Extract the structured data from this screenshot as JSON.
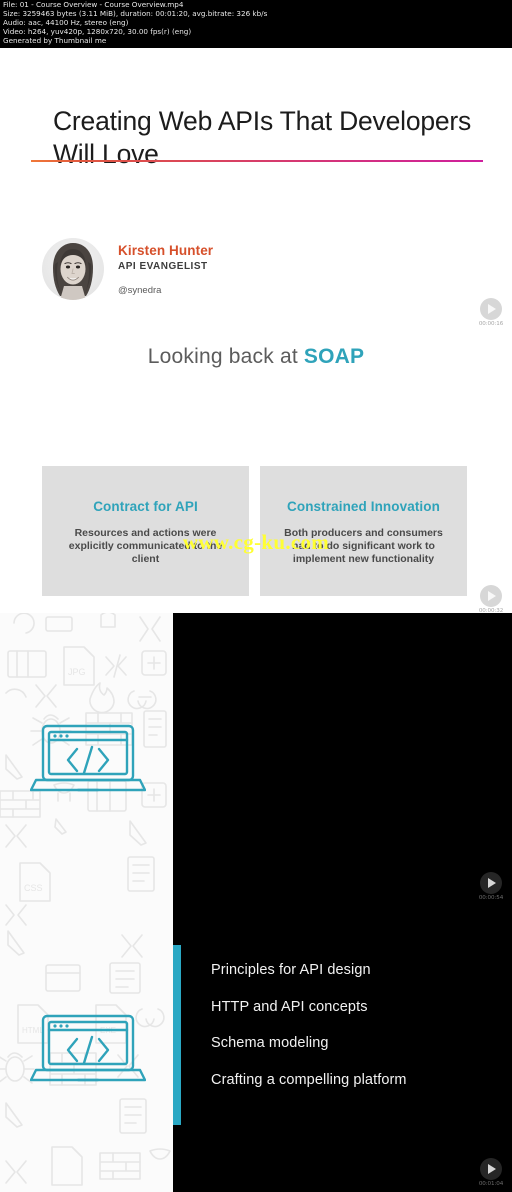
{
  "info_header": {
    "lines": [
      "File: 01 - Course Overview - Course Overview.mp4",
      "Size: 3259463 bytes (3.11 MiB), duration: 00:01:20, avg.bitrate: 326 kb/s",
      "Audio: aac, 44100 Hz, stereo (eng)",
      "Video: h264, yuv420p, 1280x720, 30.00 fps(r) (eng)",
      "Generated by Thumbnail me"
    ]
  },
  "title_slide": {
    "title": "Creating Web APIs That Developers Will Love",
    "author_name": "Kirsten Hunter",
    "author_role": "API EVANGELIST",
    "author_handle": "@synedra",
    "avatar_icon": "person-photo-avatar",
    "rule_gradient_from": "#f07838",
    "rule_gradient_to": "#cf1f9d",
    "author_name_color": "#d6502b"
  },
  "soap_slide": {
    "heading_prefix": "Looking back at ",
    "heading_keyword": "SOAP",
    "keyword_color": "#2fa3ba",
    "cards": [
      {
        "head": "Contract for API",
        "body": "Resources and actions were explicitly communicated to the client"
      },
      {
        "head": "Constrained Innovation",
        "body": "Both producers and consumers had to do significant work to implement new functionality"
      }
    ]
  },
  "watermark": {
    "text": "www.cg-ku.com",
    "color": "#ffff33"
  },
  "agenda_slide": {
    "accent_color": "#2aa8c4",
    "pattern_icons": [
      "code-brackets-icon",
      "jpg-file-icon",
      "css-file-icon",
      "html-file-icon",
      "exe-file-icon",
      "bug-icon",
      "firewall-brick-icon",
      "cursor-arrow-icon",
      "link-chain-icon",
      "browser-window-icon",
      "document-lines-icon",
      "flowchart-icon"
    ],
    "laptop_icon": "laptop-code-icon",
    "items": [
      "Principles for API design",
      "HTTP and API concepts",
      "Schema modeling",
      "Crafting a compelling platform"
    ]
  },
  "play_overlays": [
    {
      "icon": "play-button-icon",
      "time": "00:00:16"
    },
    {
      "icon": "play-button-icon",
      "time": "00:00:32"
    },
    {
      "icon": "play-button-icon",
      "time": "00:00:54"
    },
    {
      "icon": "play-button-icon",
      "time": "00:01:04"
    }
  ]
}
